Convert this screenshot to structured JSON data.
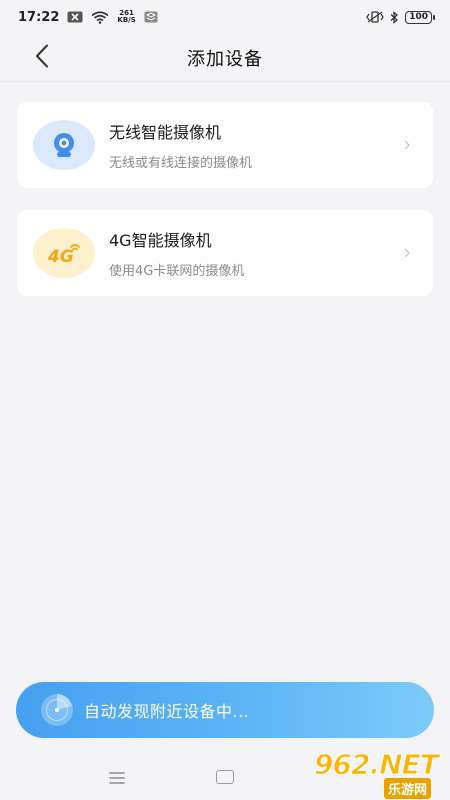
{
  "status_bar": {
    "time": "17:22",
    "net_speed_value": "261",
    "net_speed_unit": "KB/S",
    "battery": "100"
  },
  "header": {
    "title": "添加设备"
  },
  "devices": [
    {
      "title": "无线智能摄像机",
      "subtitle": "无线或有线连接的摄像机",
      "icon": "camera-icon",
      "icon_bg": "#dbe9fb"
    },
    {
      "title": "4G智能摄像机",
      "subtitle": "使用4G卡联网的摄像机",
      "icon": "4g-icon",
      "icon_bg": "#fdf0cc",
      "icon_text": "4G"
    }
  ],
  "discover": {
    "text": "自动发现附近设备中..."
  },
  "watermark": {
    "big": "962.NET",
    "small": "乐游网"
  },
  "colors": {
    "accent": "#4aa3f0",
    "four_g": "#f3a712",
    "camera_blue": "#3d8ef0"
  }
}
